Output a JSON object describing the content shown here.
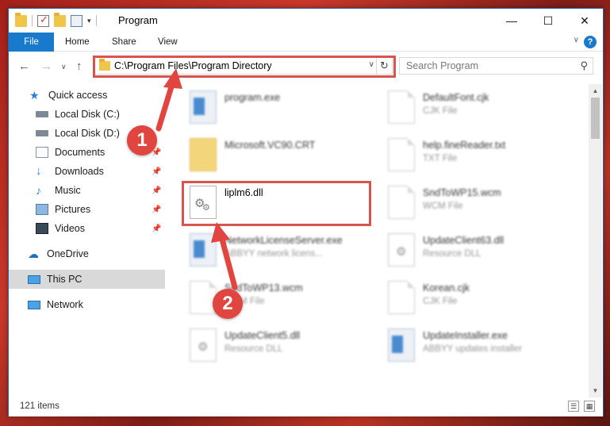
{
  "window": {
    "title": "Program",
    "controls": {
      "minimize": "—",
      "maximize": "☐",
      "close": "✕"
    }
  },
  "ribbon": {
    "tabs": [
      "File",
      "Home",
      "Share",
      "View"
    ],
    "help": "?",
    "expand": "∨"
  },
  "navigation": {
    "back": "←",
    "forward": "→",
    "recent": "∨",
    "up": "↑",
    "address_path": "C:\\Program Files\\Program Directory",
    "refresh": "↻",
    "search_placeholder": "Search Program",
    "search_icon": "⚲"
  },
  "sidebar": {
    "items": [
      {
        "label": "Quick access",
        "icon": "star-icon"
      },
      {
        "label": "Local Disk (C:)",
        "icon": "drive-icon"
      },
      {
        "label": "Local Disk (D:)",
        "icon": "drive-icon"
      },
      {
        "label": "Documents",
        "icon": "documents-icon"
      },
      {
        "label": "Downloads",
        "icon": "download-icon"
      },
      {
        "label": "Music",
        "icon": "music-icon"
      },
      {
        "label": "Pictures",
        "icon": "pictures-icon"
      },
      {
        "label": "Videos",
        "icon": "videos-icon"
      },
      {
        "label": "OneDrive",
        "icon": "cloud-icon"
      },
      {
        "label": "This PC",
        "icon": "computer-icon"
      },
      {
        "label": "Network",
        "icon": "network-icon"
      }
    ],
    "selected": "This PC"
  },
  "files": {
    "left_column": [
      {
        "name": "program.exe",
        "type": ""
      },
      {
        "name": "Microsoft.VC90.CRT",
        "type": ""
      },
      {
        "name": "liplm6.dll",
        "type": ""
      },
      {
        "name": "NetworkLicenseServer.exe",
        "type": "ABBYY network licens..."
      },
      {
        "name": "SndToWP13.wcm",
        "type": "WCM File"
      },
      {
        "name": "UpdateClient5.dll",
        "type": "Resource DLL"
      }
    ],
    "right_column": [
      {
        "name": "DefaultFont.cjk",
        "type": "CJK File"
      },
      {
        "name": "help.fineReader.txt",
        "type": "TXT File"
      },
      {
        "name": "SndToWP15.wcm",
        "type": "WCM File"
      },
      {
        "name": "UpdateClient63.dll",
        "type": "Resource DLL"
      },
      {
        "name": "Korean.cjk",
        "type": "CJK File"
      },
      {
        "name": "UpdateInstaller.exe",
        "type": "ABBYY updates installer"
      }
    ]
  },
  "status": {
    "item_count": "121 items"
  },
  "annotations": {
    "step1": "1",
    "step2": "2",
    "color": "#e0463f"
  },
  "colors": {
    "accent": "#1979ca",
    "highlight": "#d9534f"
  }
}
